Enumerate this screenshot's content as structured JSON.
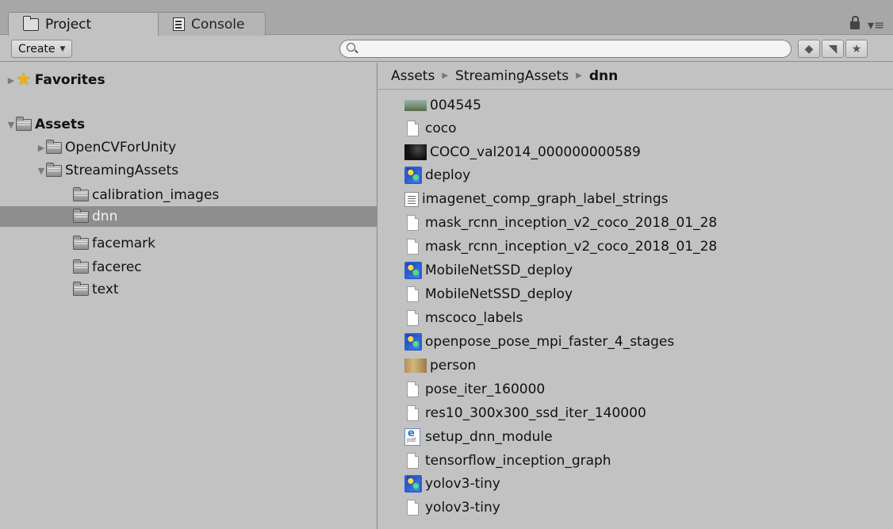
{
  "tabs": [
    {
      "label": "Project",
      "icon": "folder-icon",
      "active": true
    },
    {
      "label": "Console",
      "icon": "console-icon",
      "active": false
    }
  ],
  "toolbar": {
    "create_label": "Create",
    "search_value": "",
    "buttons": [
      "filter-by-type-icon",
      "filter-by-label-icon",
      "favorite-star-icon"
    ]
  },
  "tree": {
    "favorites_label": "Favorites",
    "assets_label": "Assets",
    "items": [
      {
        "label": "OpenCVForUnity",
        "indent": 1,
        "expanded": false,
        "selected": false
      },
      {
        "label": "StreamingAssets",
        "indent": 1,
        "expanded": true,
        "selected": false
      },
      {
        "label": "calibration_images",
        "indent": 2,
        "selected": false
      },
      {
        "label": "dnn",
        "indent": 2,
        "selected": true
      },
      {
        "label": "facemark",
        "indent": 2,
        "selected": false
      },
      {
        "label": "facerec",
        "indent": 2,
        "selected": false
      },
      {
        "label": "text",
        "indent": 2,
        "selected": false
      }
    ]
  },
  "breadcrumb": [
    "Assets",
    "StreamingAssets",
    "dnn"
  ],
  "files": [
    {
      "name": "004545",
      "icon": "image-thumbnail-icon"
    },
    {
      "name": "coco",
      "icon": "document-icon"
    },
    {
      "name": "COCO_val2014_000000000589",
      "icon": "image-thumbnail-icon"
    },
    {
      "name": "deploy",
      "icon": "model-file-icon"
    },
    {
      "name": "imagenet_comp_graph_label_strings",
      "icon": "text-file-icon"
    },
    {
      "name": "mask_rcnn_inception_v2_coco_2018_01_28",
      "icon": "document-icon"
    },
    {
      "name": "mask_rcnn_inception_v2_coco_2018_01_28",
      "icon": "document-icon"
    },
    {
      "name": "MobileNetSSD_deploy",
      "icon": "model-file-icon"
    },
    {
      "name": "MobileNetSSD_deploy",
      "icon": "document-icon"
    },
    {
      "name": "mscoco_labels",
      "icon": "document-icon"
    },
    {
      "name": "openpose_pose_mpi_faster_4_stages",
      "icon": "model-file-icon"
    },
    {
      "name": "person",
      "icon": "image-thumbnail-icon"
    },
    {
      "name": "pose_iter_160000",
      "icon": "document-icon"
    },
    {
      "name": "res10_300x300_ssd_iter_140000",
      "icon": "document-icon"
    },
    {
      "name": "setup_dnn_module",
      "icon": "pdf-file-icon"
    },
    {
      "name": "tensorflow_inception_graph",
      "icon": "document-icon"
    },
    {
      "name": "yolov3-tiny",
      "icon": "model-file-icon"
    },
    {
      "name": "yolov3-tiny",
      "icon": "document-icon"
    }
  ]
}
